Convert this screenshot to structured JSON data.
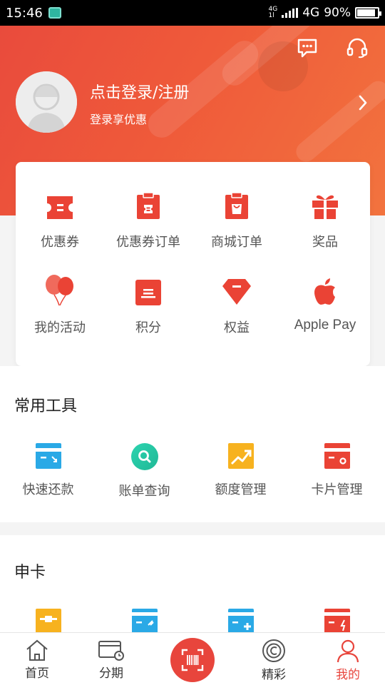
{
  "status_bar": {
    "time": "15:46",
    "network": "4G",
    "network_small_top": "4G",
    "network_small_bottom": "1l",
    "battery_percent": "90%",
    "battery_level": 0.9
  },
  "header": {
    "login_title": "点击登录/注册",
    "login_subtitle": "登录享优惠",
    "icons": [
      "message-icon",
      "headset-icon",
      "chevron-right-icon"
    ]
  },
  "quick_grid": [
    {
      "label": "优惠券",
      "icon": "coupon-icon"
    },
    {
      "label": "优惠券订单",
      "icon": "coupon-order-icon"
    },
    {
      "label": "商城订单",
      "icon": "mall-order-icon"
    },
    {
      "label": "奖品",
      "icon": "gift-icon"
    },
    {
      "label": "我的活动",
      "icon": "balloon-icon"
    },
    {
      "label": "积分",
      "icon": "points-icon"
    },
    {
      "label": "权益",
      "icon": "diamond-icon"
    },
    {
      "label": "Apple Pay",
      "icon": "apple-icon"
    }
  ],
  "tools": {
    "title": "常用工具",
    "items": [
      {
        "label": "快速还款",
        "icon": "quick-repay-icon"
      },
      {
        "label": "账单查询",
        "icon": "bill-search-icon"
      },
      {
        "label": "额度管理",
        "icon": "credit-limit-icon"
      },
      {
        "label": "卡片管理",
        "icon": "card-manage-icon"
      }
    ]
  },
  "apply": {
    "title": "申卡",
    "items": [
      {
        "icon": "card-yellow-icon"
      },
      {
        "icon": "card-blue-tool-icon"
      },
      {
        "icon": "card-blue-add-icon"
      },
      {
        "icon": "card-red-flash-icon"
      }
    ]
  },
  "bottom_nav": {
    "items": [
      {
        "label": "首页",
        "icon": "home-icon"
      },
      {
        "label": "分期",
        "icon": "installment-icon"
      },
      {
        "label": "精彩",
        "icon": "discover-icon"
      },
      {
        "label": "我的",
        "icon": "profile-icon",
        "active": true
      }
    ],
    "center_icon": "scan-barcode-icon"
  },
  "colors": {
    "accent": "#e8453c",
    "header_start": "#e94b3c",
    "header_end": "#f2733e",
    "blue": "#2aa9e6",
    "teal": "#25c6a5",
    "yellow": "#f7b21f"
  }
}
